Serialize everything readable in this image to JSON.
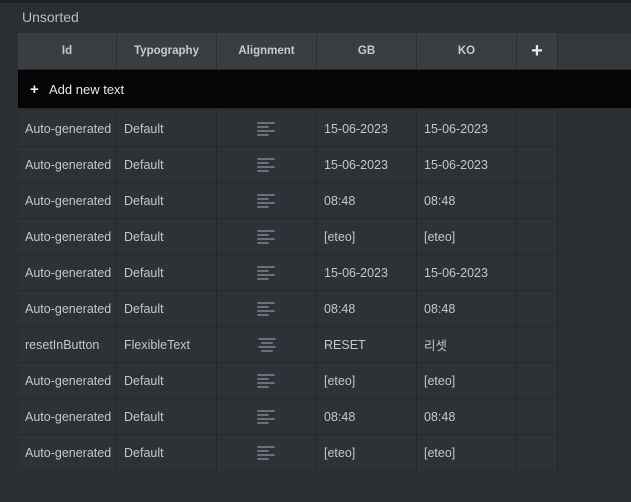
{
  "section": {
    "title": "Unsorted"
  },
  "table": {
    "columns": [
      "Id",
      "Typography",
      "Alignment",
      "GB",
      "KO"
    ],
    "add_column_glyph": "+",
    "add_text": {
      "glyph": "+",
      "label": "Add new text"
    },
    "rows": [
      {
        "id": "Auto-generated",
        "typography": "Default",
        "alignment": "left-align-icon",
        "gb": "15-06-2023",
        "ko": "15-06-2023"
      },
      {
        "id": "Auto-generated",
        "typography": "Default",
        "alignment": "left-align-icon",
        "gb": "15-06-2023",
        "ko": "15-06-2023"
      },
      {
        "id": "Auto-generated",
        "typography": "Default",
        "alignment": "left-align-icon",
        "gb": "08:48",
        "ko": "08:48"
      },
      {
        "id": "Auto-generated",
        "typography": "Default",
        "alignment": "left-align-icon",
        "gb": "[eteo]",
        "ko": "[eteo]"
      },
      {
        "id": "Auto-generated",
        "typography": "Default",
        "alignment": "left-align-icon",
        "gb": "15-06-2023",
        "ko": "15-06-2023"
      },
      {
        "id": "Auto-generated",
        "typography": "Default",
        "alignment": "left-align-icon",
        "gb": "08:48",
        "ko": "08:48"
      },
      {
        "id": "resetInButton",
        "typography": "FlexibleText",
        "alignment": "center-align-icon",
        "gb": "RESET",
        "ko": "리셋"
      },
      {
        "id": "Auto-generated",
        "typography": "Default",
        "alignment": "left-align-icon",
        "gb": "[eteo]",
        "ko": "[eteo]"
      },
      {
        "id": "Auto-generated",
        "typography": "Default",
        "alignment": "left-align-icon",
        "gb": "08:48",
        "ko": "08:48"
      },
      {
        "id": "Auto-generated",
        "typography": "Default",
        "alignment": "left-align-icon",
        "gb": "[eteo]",
        "ko": "[eteo]"
      }
    ]
  },
  "colors": {
    "background": "#2b2e33",
    "header": "#3a3d42",
    "add_row": "#050505",
    "text": "#c4c7cc"
  }
}
